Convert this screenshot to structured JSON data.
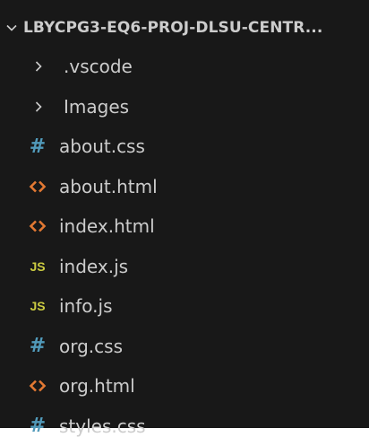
{
  "explorer": {
    "folder_title": "LBYCPG3-EQ6-PROJ-DLSU-CENTR...",
    "colors": {
      "background": "#181818",
      "text": "#cccccc",
      "css_icon": "#519aba",
      "html_icon": "#e37933",
      "js_icon": "#cbcb41"
    },
    "items": [
      {
        "label": ".vscode",
        "type": "folder",
        "icon": "chevron-right-icon"
      },
      {
        "label": "Images",
        "type": "folder",
        "icon": "chevron-right-icon"
      },
      {
        "label": "about.css",
        "type": "css",
        "icon": "css-file-icon"
      },
      {
        "label": "about.html",
        "type": "html",
        "icon": "html-file-icon"
      },
      {
        "label": "index.html",
        "type": "html",
        "icon": "html-file-icon"
      },
      {
        "label": "index.js",
        "type": "js",
        "icon": "js-file-icon",
        "icon_text": "JS"
      },
      {
        "label": "info.js",
        "type": "js",
        "icon": "js-file-icon",
        "icon_text": "JS"
      },
      {
        "label": "org.css",
        "type": "css",
        "icon": "css-file-icon"
      },
      {
        "label": "org.html",
        "type": "html",
        "icon": "html-file-icon"
      },
      {
        "label": "styles.css",
        "type": "css",
        "icon": "css-file-icon"
      }
    ]
  }
}
